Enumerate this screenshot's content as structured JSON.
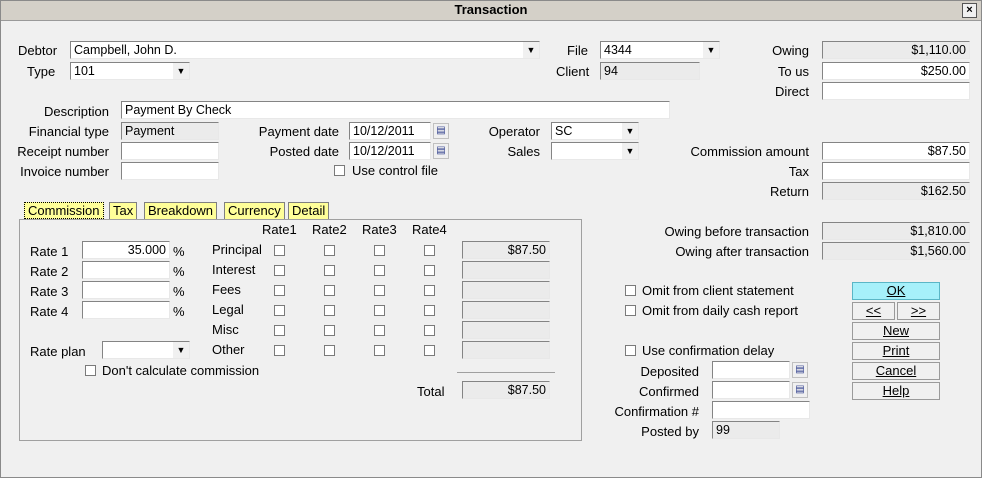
{
  "window": {
    "title": "Transaction",
    "close": "×"
  },
  "header": {
    "debtor_label": "Debtor",
    "debtor_value": "Campbell, John D.",
    "type_label": "Type",
    "type_value": "101",
    "file_label": "File",
    "file_value": "4344",
    "client_label": "Client",
    "client_value": "94",
    "owing_label": "Owing",
    "owing_value": "$1,110.00",
    "to_us_label": "To us",
    "to_us_value": "$250.00",
    "direct_label": "Direct",
    "direct_value": ""
  },
  "details": {
    "description_label": "Description",
    "description_value": "Payment By Check",
    "financial_type_label": "Financial type",
    "financial_type_value": "Payment",
    "receipt_label": "Receipt number",
    "receipt_value": "",
    "invoice_label": "Invoice number",
    "invoice_value": "",
    "payment_date_label": "Payment date",
    "payment_date_value": "10/12/2011",
    "posted_date_label": "Posted date",
    "posted_date_value": "10/12/2011",
    "use_control_file_label": "Use control file",
    "operator_label": "Operator",
    "operator_value": "SC",
    "sales_label": "Sales",
    "sales_value": "",
    "commission_amount_label": "Commission amount",
    "commission_amount_value": "$87.50",
    "tax_label": "Tax",
    "tax_value": "",
    "return_label": "Return",
    "return_value": "$162.50",
    "owing_before_label": "Owing before transaction",
    "owing_before_value": "$1,810.00",
    "owing_after_label": "Owing after transaction",
    "owing_after_value": "$1,560.00"
  },
  "tabs": [
    "Commission",
    "Tax",
    "Breakdown",
    "Currency",
    "Detail"
  ],
  "commission": {
    "rate_headers": [
      "Rate1",
      "Rate2",
      "Rate3",
      "Rate4"
    ],
    "rates": [
      {
        "label": "Rate 1",
        "value": "35.000",
        "pct": "%"
      },
      {
        "label": "Rate 2",
        "value": "",
        "pct": "%"
      },
      {
        "label": "Rate 3",
        "value": "",
        "pct": "%"
      },
      {
        "label": "Rate 4",
        "value": "",
        "pct": "%"
      }
    ],
    "categories": [
      {
        "label": "Principal",
        "amount": "$87.50"
      },
      {
        "label": "Interest",
        "amount": ""
      },
      {
        "label": "Fees",
        "amount": ""
      },
      {
        "label": "Legal",
        "amount": ""
      },
      {
        "label": "Misc",
        "amount": ""
      },
      {
        "label": "Other",
        "amount": ""
      }
    ],
    "rate_plan_label": "Rate plan",
    "rate_plan_value": "",
    "dont_calculate_label": "Don't calculate commission",
    "total_label": "Total",
    "total_value": "$87.50"
  },
  "options": {
    "omit_client_label": "Omit from client statement",
    "omit_daily_label": "Omit from daily cash report",
    "use_confirmation_label": "Use confirmation delay",
    "deposited_label": "Deposited",
    "deposited_value": "",
    "confirmed_label": "Confirmed",
    "confirmed_value": "",
    "confirmation_no_label": "Confirmation #",
    "confirmation_no_value": "",
    "posted_by_label": "Posted by",
    "posted_by_value": "99"
  },
  "buttons": {
    "ok": "OK",
    "prev": "<<",
    "next": ">>",
    "new": "New",
    "print": "Print",
    "cancel": "Cancel",
    "help": "Help"
  },
  "icons": {
    "dropdown": "chevron-down-icon",
    "calendar": "calendar-icon",
    "close": "close-icon"
  }
}
